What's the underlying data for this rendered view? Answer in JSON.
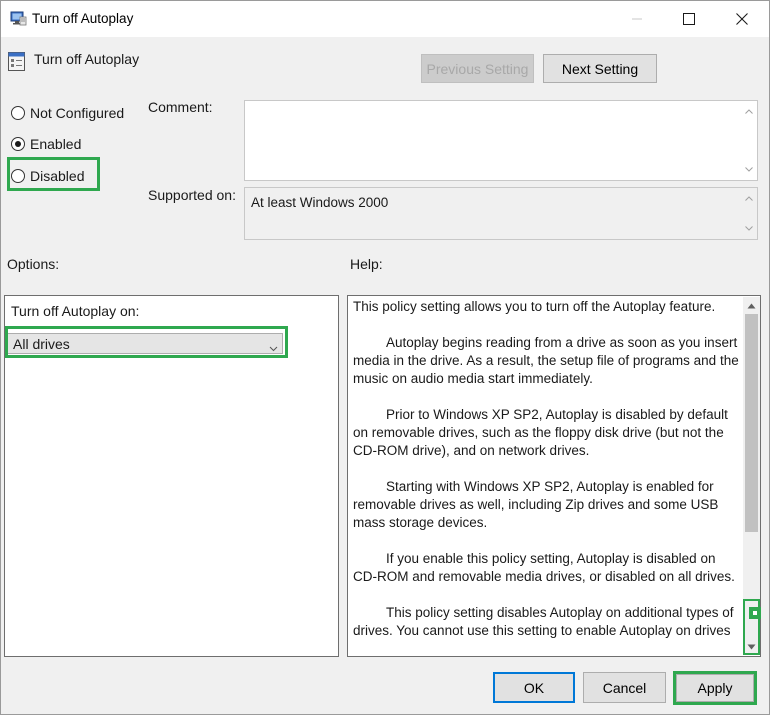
{
  "window": {
    "title": "Turn off Autoplay"
  },
  "header": {
    "setting_name": "Turn off Autoplay",
    "previous_label": "Previous Setting",
    "next_label": "Next Setting"
  },
  "state": {
    "options": [
      {
        "label": "Not Configured",
        "checked": false
      },
      {
        "label": "Enabled",
        "checked": true
      },
      {
        "label": "Disabled",
        "checked": false
      }
    ]
  },
  "comment": {
    "label": "Comment:",
    "value": ""
  },
  "supported": {
    "label": "Supported on:",
    "value": "At least Windows 2000"
  },
  "options_section": {
    "label": "Options:",
    "field_label": "Turn off Autoplay on:",
    "selected": "All drives"
  },
  "help_section": {
    "label": "Help:",
    "paragraphs": [
      "This policy setting allows you to turn off the Autoplay feature.",
      "Autoplay begins reading from a drive as soon as you insert media in the drive. As a result, the setup file of programs and the music on audio media start immediately.",
      "Prior to Windows XP SP2, Autoplay is disabled by default on removable drives, such as the floppy disk drive (but not the CD-ROM drive), and on network drives.",
      "Starting with Windows XP SP2, Autoplay is enabled for removable drives as well, including Zip drives and some USB mass storage devices.",
      "If you enable this policy setting, Autoplay is disabled on CD-ROM and removable media drives, or disabled on all drives.",
      "This policy setting disables Autoplay on additional types of drives. You cannot use this setting to enable Autoplay on drives"
    ]
  },
  "footer": {
    "ok_label": "OK",
    "cancel_label": "Cancel",
    "apply_label": "Apply"
  },
  "colors": {
    "highlight": "#2fa84f",
    "focus_blue": "#0078d7"
  },
  "icons": {
    "title": "group-policy-icon",
    "header": "policy-setting-icon",
    "minimize": "minimize-icon",
    "maximize": "maximize-icon",
    "close": "close-icon"
  }
}
